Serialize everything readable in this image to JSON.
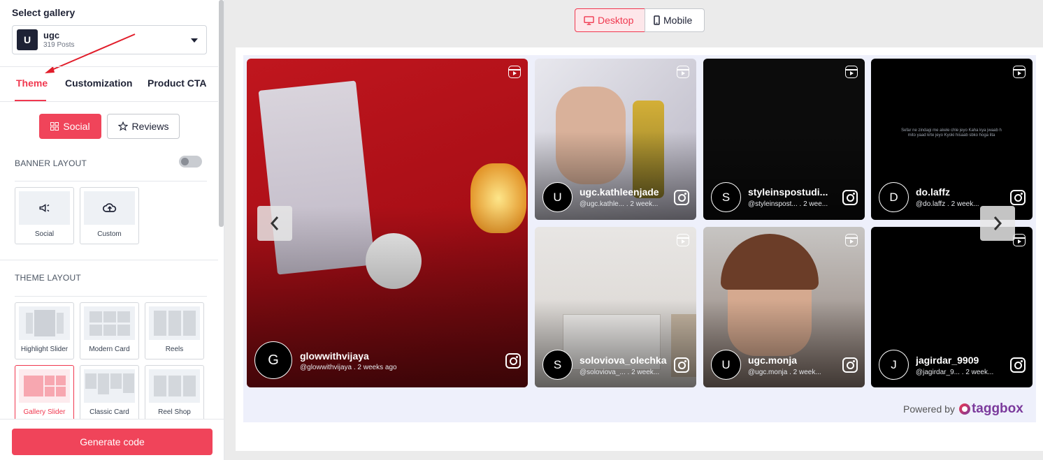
{
  "sidebar": {
    "title": "Select gallery",
    "gallery": {
      "initial": "U",
      "name": "ugc",
      "count": "319 Posts"
    },
    "tabs": [
      "Theme",
      "Customization",
      "Product CTA"
    ],
    "active_tab": "Theme",
    "mode_buttons": {
      "social": "Social",
      "reviews": "Reviews"
    },
    "banner_layout_label": "BANNER LAYOUT",
    "banner_toggle_on": false,
    "banner_cards": [
      "Social",
      "Custom"
    ],
    "theme_layout_label": "THEME LAYOUT",
    "theme_cards": [
      "Highlight Slider",
      "Modern Card",
      "Reels",
      "Gallery Slider",
      "Classic Card",
      "Reel Shop"
    ],
    "selected_theme": "Gallery Slider",
    "generate_label": "Generate code"
  },
  "view_toggle": {
    "desktop": "Desktop",
    "mobile": "Mobile",
    "active": "Desktop"
  },
  "posts": [
    {
      "initial": "G",
      "name": "glowwithvijaya",
      "handle": "@glowwithvijaya",
      "time": "2 weeks ago"
    },
    {
      "initial": "U",
      "name": "ugc.kathleenjade",
      "handle": "@ugc.kathle...",
      "time": "2 week..."
    },
    {
      "initial": "S",
      "name": "styleinspostudi...",
      "handle": "@styleinspost...",
      "time": "2 wee..."
    },
    {
      "initial": "D",
      "name": "do.laffz",
      "handle": "@do.laffz",
      "time": "2 week..."
    },
    {
      "initial": "S",
      "name": "soloviova_olechka",
      "handle": "@soloviova_...",
      "time": "2 week..."
    },
    {
      "initial": "U",
      "name": "ugc.monja",
      "handle": "@ugc.monja",
      "time": "2 week..."
    },
    {
      "initial": "J",
      "name": "jagirdar_9909",
      "handle": "@jagirdar_9...",
      "time": "2 week..."
    }
  ],
  "post_overlay_text": "Sefar ne zindagi me akele chle jeyo Kaha kya jwaab h mito yaad krte jeyo Kyoki hisaab sbko hoga lita",
  "powered_by": "Powered by",
  "brand": "taggbox",
  "colors": {
    "accent": "#f0384f",
    "brand": "#7b3a9c"
  }
}
